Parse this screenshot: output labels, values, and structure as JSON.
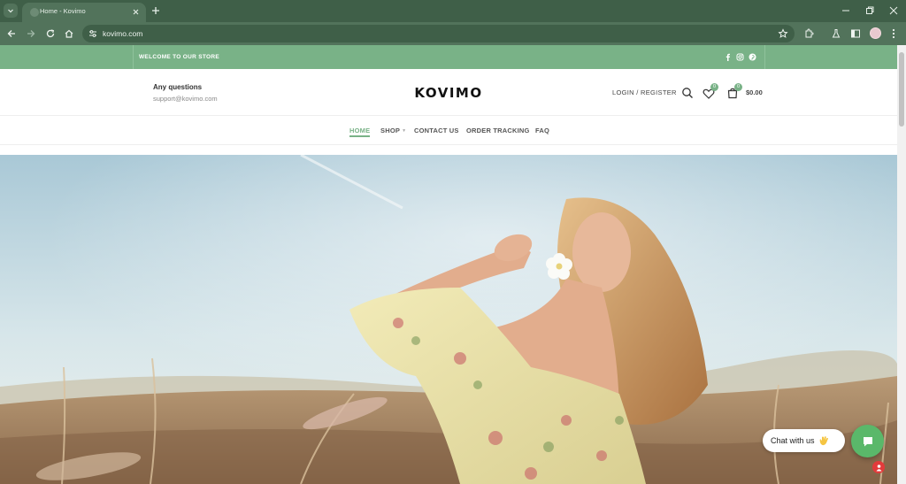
{
  "browser": {
    "tab_title": "Home - Kovimo",
    "url": "kovimo.com"
  },
  "topbar": {
    "welcome": "WELCOME TO OUR STORE",
    "socials": [
      "facebook-icon",
      "instagram-icon",
      "pinterest-icon"
    ]
  },
  "header": {
    "questions_label": "Any questions",
    "support_email": "support@kovimo.com",
    "logo": "KOVIMO",
    "login_label": "LOGIN / REGISTER",
    "wishlist_count": "0",
    "cart_count": "0",
    "cart_total": "$0.00"
  },
  "nav": {
    "items": [
      {
        "label": "HOME",
        "active": true
      },
      {
        "label": "SHOP",
        "active": false
      },
      {
        "label": "CONTACT US",
        "active": false
      },
      {
        "label": "ORDER TRACKING",
        "active": false
      },
      {
        "label": "FAQ",
        "active": false
      }
    ]
  },
  "chat": {
    "label": "Chat with us"
  },
  "colors": {
    "accent": "#79b287",
    "chrome_dark": "#3f5f48",
    "chrome": "#52735b",
    "chat_green": "#5ab86a"
  }
}
